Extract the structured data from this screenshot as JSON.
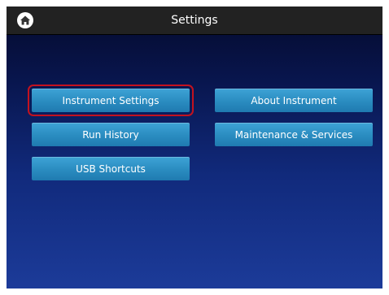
{
  "header": {
    "title": "Settings",
    "home_icon": "home-icon"
  },
  "menu": {
    "instrument_settings": "Instrument Settings",
    "about_instrument": "About Instrument",
    "run_history": "Run History",
    "maintenance_services": "Maintenance & Services",
    "usb_shortcuts": "USB Shortcuts",
    "selected": "Instrument Settings"
  },
  "colors": {
    "button": "#2a8cc0",
    "selection_outline": "#c3121f",
    "topbar": "#222222",
    "background_top": "#050a2c",
    "background_bottom": "#1c3b99"
  }
}
